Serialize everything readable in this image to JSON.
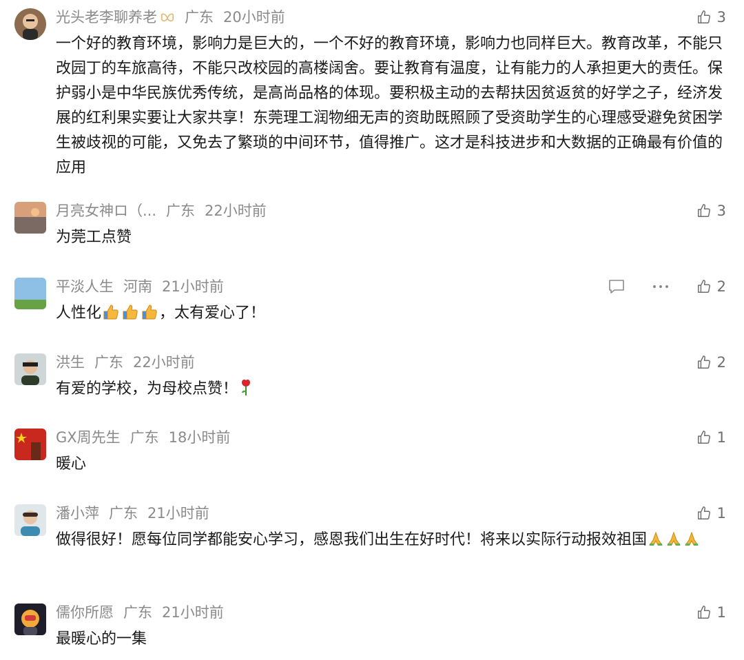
{
  "colors": {
    "meta": "#8a8a8a",
    "text": "#1a1a1a",
    "like": "#6e6e6e"
  },
  "comments": [
    {
      "username": "光头老李聊养老",
      "region": "广东",
      "time": "20小时前",
      "badge_icon": "butterfly-badge-icon",
      "likes": "3",
      "text": "一个好的教育环境，影响力是巨大的，一个不好的教育环境，影响力也同样巨大。教育改革，不能只改园丁的车旅高待，不能只改校园的高楼阔舍。要让教育有温度，让有能力的人承担更大的责任。保护弱小是中华民族优秀传统，是高尚品格的体现。要积极主动的去帮扶因贫返贫的好学之子，经济发展的红利果实要让大家共享！东莞理工润物细无声的资助既照顾了受资助学生的心理感受避免贫困学生被歧视的可能，又免去了繁琐的中间环节，值得推广。这才是科技进步和大数据的正确最有价值的应用"
    },
    {
      "username": "月亮女神ロ（...",
      "region": "广东",
      "time": "22小时前",
      "likes": "3",
      "text": "为莞工点赞"
    },
    {
      "username": "平淡人生",
      "region": "河南",
      "time": "21小时前",
      "likes": "2",
      "text_before": "人性化",
      "emoji": "thumbs-up-icon",
      "text_after": "，太有爱心了！",
      "reply_icon": "reply-icon",
      "more_icon": "more-icon"
    },
    {
      "username": "洪生",
      "region": "广东",
      "time": "22小时前",
      "likes": "2",
      "text": "有爱的学校，为母校点赞！",
      "emoji": "rose-icon"
    },
    {
      "username": "GX周先生",
      "region": "广东",
      "time": "18小时前",
      "likes": "1",
      "text": "暖心"
    },
    {
      "username": "潘小萍",
      "region": "广东",
      "time": "21小时前",
      "likes": "1",
      "text": "做得很好！愿每位同学都能安心学习，感恩我们出生在好时代！将来以实际行动报效祖国",
      "emoji": "praying-hands-icon"
    },
    {
      "username": "儒你所愿",
      "region": "广东",
      "time": "21小时前",
      "likes": "1",
      "text": "最暖心的一集"
    }
  ]
}
